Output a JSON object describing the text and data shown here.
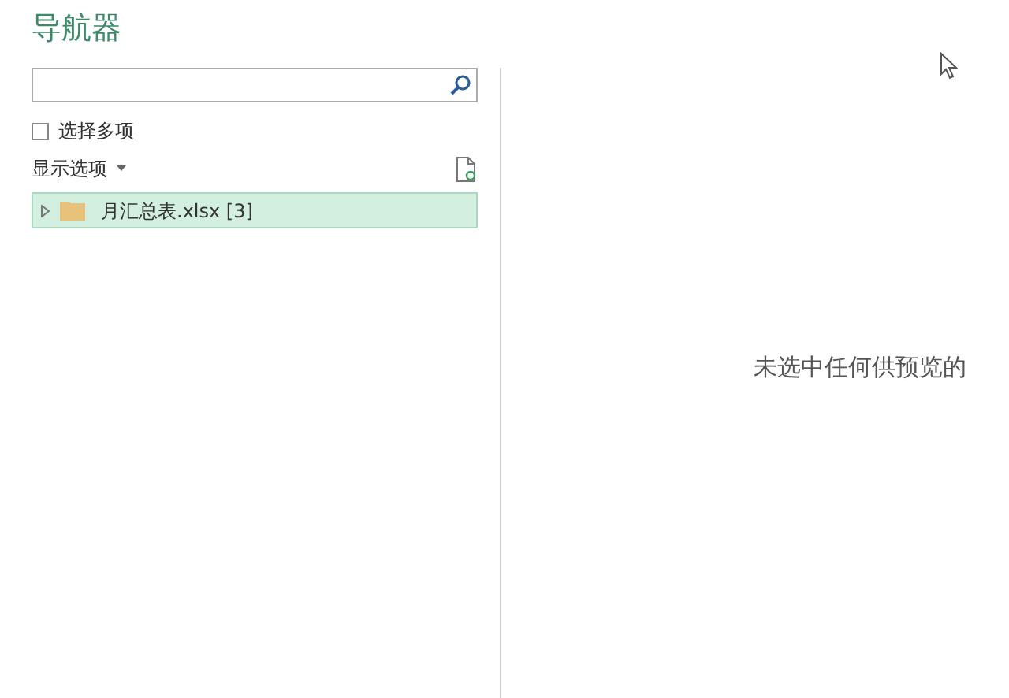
{
  "title": "导航器",
  "multi_select": {
    "label": "选择多项",
    "checked": false
  },
  "display_options": {
    "label": "显示选项"
  },
  "tree": [
    {
      "label": "月汇总表.xlsx [3]",
      "selected": true,
      "expanded": false
    }
  ],
  "preview": {
    "message": "未选中任何供预览的"
  }
}
